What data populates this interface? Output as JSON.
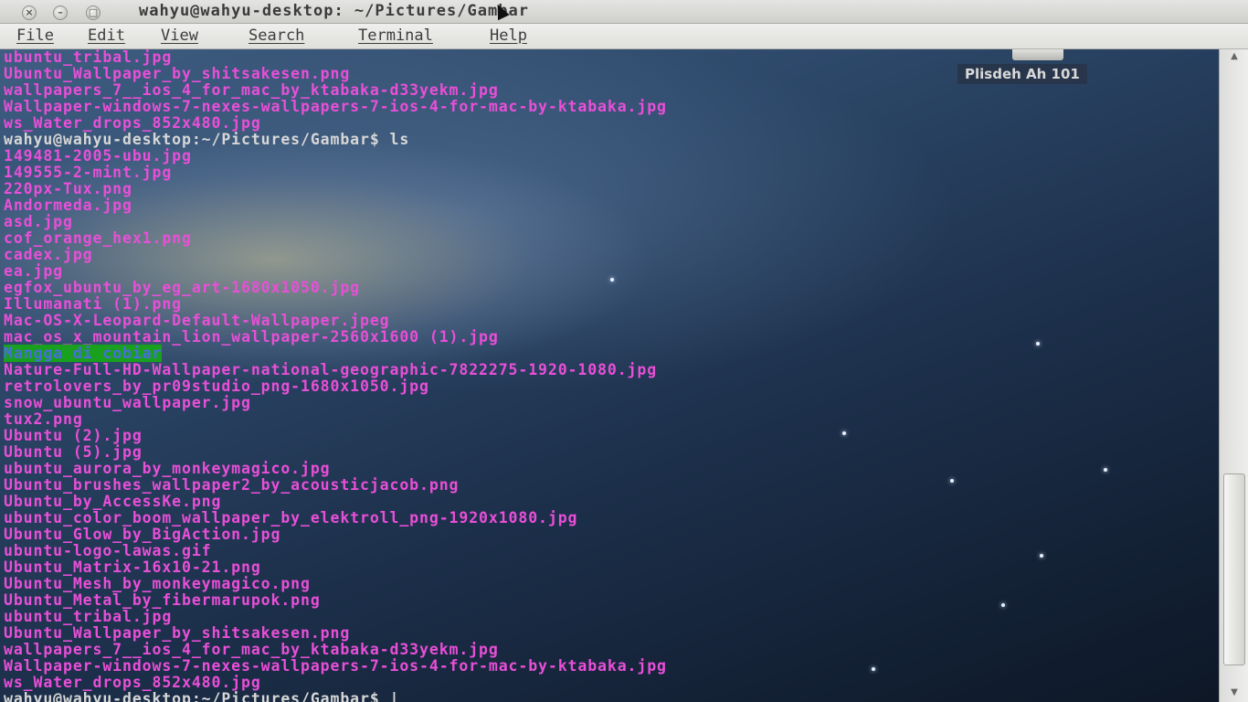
{
  "window": {
    "title": "wahyu@wahyu-desktop: ~/Pictures/Gambar",
    "close_glyph": "×",
    "min_glyph": "–",
    "max_glyph": "□"
  },
  "menubar": {
    "items": [
      {
        "label": "File"
      },
      {
        "label": "Edit"
      },
      {
        "label": "View"
      },
      {
        "label": "Search"
      },
      {
        "label": "Terminal"
      },
      {
        "label": "Help"
      }
    ]
  },
  "desktop": {
    "label": "Plisdeh Ah 101"
  },
  "terminal": {
    "prompt_color": "#d7d7d7",
    "file_color": "#e94fd8",
    "highlight_bg": "#18a01e",
    "lines": [
      {
        "text": "ubuntu_tribal.jpg"
      },
      {
        "text": "Ubuntu_Wallpaper_by_shitsakesen.png"
      },
      {
        "text": "wallpapers_7__ios_4_for_mac_by_ktabaka-d33yekm.jpg"
      },
      {
        "text": "Wallpaper-windows-7-nexes-wallpapers-7-ios-4-for-mac-by-ktabaka.jpg"
      },
      {
        "text": "ws_Water_drops_852x480.jpg"
      },
      {
        "text": "wahyu@wahyu-desktop:~/Pictures/Gambar$ ls",
        "kind": "prompt"
      },
      {
        "text": "149481-2005-ubu.jpg"
      },
      {
        "text": "149555-2-mint.jpg"
      },
      {
        "text": "220px-Tux.png"
      },
      {
        "text": "Andormeda.jpg"
      },
      {
        "text": "asd.jpg"
      },
      {
        "text": "cof_orange_hex1.png"
      },
      {
        "text": "cadex.jpg"
      },
      {
        "text": "ea.jpg"
      },
      {
        "text": "egfox_ubuntu_by_eg_art-1680x1050.jpg"
      },
      {
        "text": "Illumanati (1).png"
      },
      {
        "text": "Mac-OS-X-Leopard-Default-Wallpaper.jpeg"
      },
      {
        "text": "mac_os_x_mountain_lion_wallpaper-2560x1600 (1).jpg"
      },
      {
        "text": "Mangga di cobiar",
        "kind": "highlight"
      },
      {
        "text": "Nature-Full-HD-Wallpaper-national-geographic-7822275-1920-1080.jpg"
      },
      {
        "text": "retrolovers_by_pr09studio_png-1680x1050.jpg"
      },
      {
        "text": "snow_ubuntu_wallpaper.jpg"
      },
      {
        "text": "tux2.png"
      },
      {
        "text": "Ubuntu (2).jpg"
      },
      {
        "text": "Ubuntu (5).jpg"
      },
      {
        "text": "ubuntu_aurora_by_monkeymagico.jpg"
      },
      {
        "text": "Ubuntu_brushes_wallpaper2_by_acousticjacob.png"
      },
      {
        "text": "Ubuntu_by_AccessKe.png"
      },
      {
        "text": "ubuntu_color_boom_wallpaper_by_elektroll_png-1920x1080.jpg"
      },
      {
        "text": "Ubuntu_Glow_by_BigAction.jpg"
      },
      {
        "text": "ubuntu-logo-lawas.gif"
      },
      {
        "text": "Ubuntu_Matrix-16x10-21.png"
      },
      {
        "text": "Ubuntu_Mesh_by_monkeymagico.png"
      },
      {
        "text": "Ubuntu_Metal_by_fibermarupok.png"
      },
      {
        "text": "ubuntu_tribal.jpg"
      },
      {
        "text": "Ubuntu_Wallpaper_by_shitsakesen.png"
      },
      {
        "text": "wallpapers_7__ios_4_for_mac_by_ktabaka-d33yekm.jpg"
      },
      {
        "text": "Wallpaper-windows-7-nexes-wallpapers-7-ios-4-for-mac-by-ktabaka.jpg"
      },
      {
        "text": "ws_Water_drops_852x480.jpg"
      },
      {
        "text": "wahyu@wahyu-desktop:~/Pictures/Gambar$ |",
        "kind": "prompt"
      }
    ]
  },
  "scrollbar": {
    "up_glyph": "▲",
    "down_glyph": "▼",
    "position_fraction": 0.95
  }
}
